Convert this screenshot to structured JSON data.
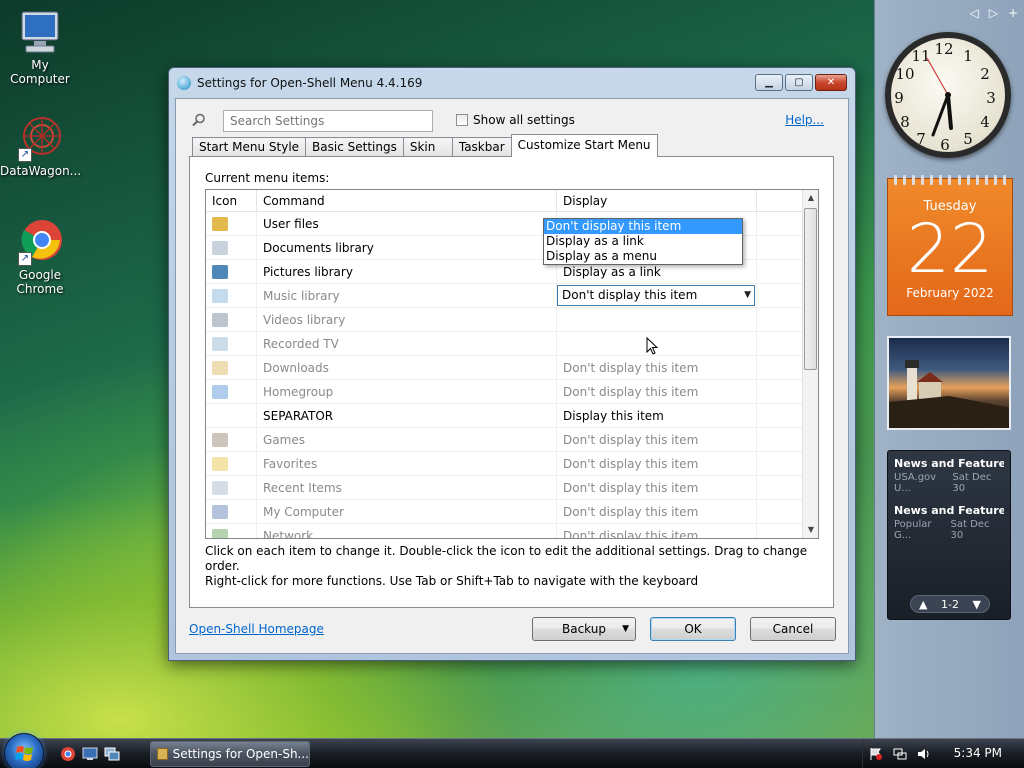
{
  "desktop": {
    "icons": [
      {
        "label": "My Computer"
      },
      {
        "label": "DataWagon..."
      },
      {
        "label": "Google Chrome"
      }
    ]
  },
  "sidebar": {
    "calendar": {
      "weekday": "Tuesday",
      "day": "22",
      "month_year": "February 2022"
    },
    "clock": {
      "numbers": [
        "12",
        "1",
        "2",
        "3",
        "4",
        "5",
        "6",
        "7",
        "8",
        "9",
        "10",
        "11"
      ]
    },
    "news": {
      "items": [
        {
          "title": "News and Features f...",
          "source": "USA.gov U...",
          "date": "Sat Dec 30"
        },
        {
          "title": "News and Features f...",
          "source": "Popular G...",
          "date": "Sat Dec 30"
        }
      ],
      "pager": "1-2"
    }
  },
  "window": {
    "title": "Settings for Open-Shell Menu 4.4.169",
    "search_placeholder": "Search Settings",
    "show_all_label": "Show all settings",
    "help_label": "Help...",
    "tabs": [
      {
        "label": "Start Menu Style"
      },
      {
        "label": "Basic Settings"
      },
      {
        "label": "Skin"
      },
      {
        "label": "Taskbar"
      },
      {
        "label": "Customize Start Menu"
      }
    ],
    "active_tab": "Customize Start Menu",
    "panel_label": "Current menu items:",
    "columns": {
      "icon": "Icon",
      "command": "Command",
      "display": "Display"
    },
    "rows": [
      {
        "command": "User files",
        "display": "Display as a link",
        "state": "dark",
        "icon_color": "#e2b84a"
      },
      {
        "command": "Documents library",
        "display": "Display as a link",
        "state": "dark",
        "icon_color": "#c9d3de"
      },
      {
        "command": "Pictures library",
        "display": "Display as a link",
        "state": "dark",
        "icon_color": "#4f88b8"
      },
      {
        "command": "Music library",
        "display": "Don't display this item",
        "state": "dim",
        "icon_color": "#7ab0d8",
        "editing": true
      },
      {
        "command": "Videos library",
        "display": "",
        "state": "dim",
        "icon_color": "#6f7f94"
      },
      {
        "command": "Recorded TV",
        "display": "",
        "state": "dim",
        "icon_color": "#8fb0cf"
      },
      {
        "command": "Downloads",
        "display": "Don't display this item",
        "state": "dim",
        "icon_color": "#d9b256"
      },
      {
        "command": "Homegroup",
        "display": "Don't display this item",
        "state": "dim",
        "icon_color": "#4d8fd0"
      },
      {
        "command": "SEPARATOR",
        "display": "Display this item",
        "state": "dark",
        "icon_color": "transparent"
      },
      {
        "command": "Games",
        "display": "Don't display this item",
        "state": "dim",
        "icon_color": "#8d7f6a"
      },
      {
        "command": "Favorites",
        "display": "Don't display this item",
        "state": "dim",
        "icon_color": "#e7c43c"
      },
      {
        "command": "Recent Items",
        "display": "Don't display this item",
        "state": "dim",
        "icon_color": "#9fb3c6"
      },
      {
        "command": "My Computer",
        "display": "Don't display this item",
        "state": "dim",
        "icon_color": "#5b77b2"
      },
      {
        "command": "Network",
        "display": "Don't display this item",
        "state": "dim",
        "icon_color": "#5c9b4e"
      }
    ],
    "dropdown": {
      "value": "Don't display this item",
      "options": [
        "Don't display this item",
        "Display as a link",
        "Display as a menu"
      ],
      "selected_index": 0
    },
    "hint_line1": "Click on each item to change it. Double-click the icon to edit the additional settings. Drag to change order.",
    "hint_line2": "Right-click for more functions. Use Tab or Shift+Tab to navigate with the keyboard",
    "homepage_link": "Open-Shell Homepage",
    "buttons": {
      "backup": "Backup",
      "ok": "OK",
      "cancel": "Cancel"
    }
  },
  "taskbar": {
    "task_label": "Settings for Open-Sh...",
    "time": "5:34 PM"
  }
}
